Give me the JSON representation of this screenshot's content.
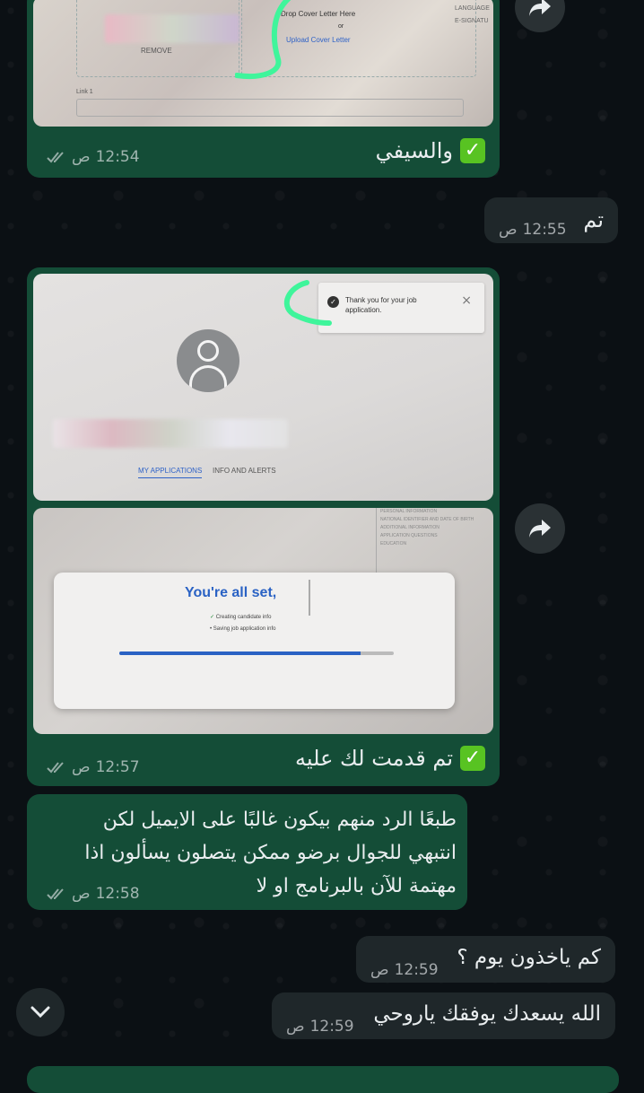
{
  "messages": [
    {
      "id": "m1",
      "text": "والسيفي",
      "has_check": true,
      "time": "12:54",
      "ampm": "ص",
      "photo": {
        "drop_text": "Drop Cover Letter Here",
        "or_text": "or",
        "upload_link": "Upload Cover Letter",
        "remove_label": "REMOVE",
        "link_label": "Link 1",
        "side_labels": [
          "LANGUAGE",
          "E-SIGNATU"
        ]
      }
    },
    {
      "id": "m2",
      "text": "تم",
      "time": "12:55",
      "ampm": "ص"
    },
    {
      "id": "m3",
      "text": "تم قدمت لك عليه",
      "has_check": true,
      "time": "12:57",
      "ampm": "ص",
      "photo_top": {
        "toast_text": "Thank you for your job application.",
        "tabs": [
          "MY APPLICATIONS",
          "INFO AND ALERTS"
        ]
      },
      "photo_bottom": {
        "heading": "You're all set,",
        "steps": [
          "Creating candidate info",
          "Saving job application info"
        ],
        "side_menu": [
          "PERSONAL INFORMATION",
          "NATIONAL IDENTIFIER AND DATE OF BIRTH",
          "ADDITIONAL INFORMATION",
          "APPLICATION QUESTIONS",
          "EDUCATION"
        ],
        "progress": 0.88
      }
    },
    {
      "id": "m4",
      "lines": [
        "طبعًا الرد منهم بيكون غالبًا على الايميل لكن",
        "انتبهي للجوال برضو ممكن يتصلون يسألون اذا",
        "مهتمة للآن بالبرنامج او لا"
      ],
      "time": "12:58",
      "ampm": "ص"
    },
    {
      "id": "m5",
      "text": "كم ياخذون يوم ؟",
      "time": "12:59",
      "ampm": "ص"
    },
    {
      "id": "m6",
      "text": "الله يسعدك يوفقك ياروحي",
      "time": "12:59",
      "ampm": "ص"
    }
  ],
  "icons": {
    "forward": "forward-arrow-icon",
    "scroll_down": "chevron-down-icon",
    "read_receipt": "double-check-icon"
  },
  "colors": {
    "outgoing": "#144d37",
    "incoming": "#1f272a",
    "background": "#0b1014",
    "check": "#58c322"
  }
}
